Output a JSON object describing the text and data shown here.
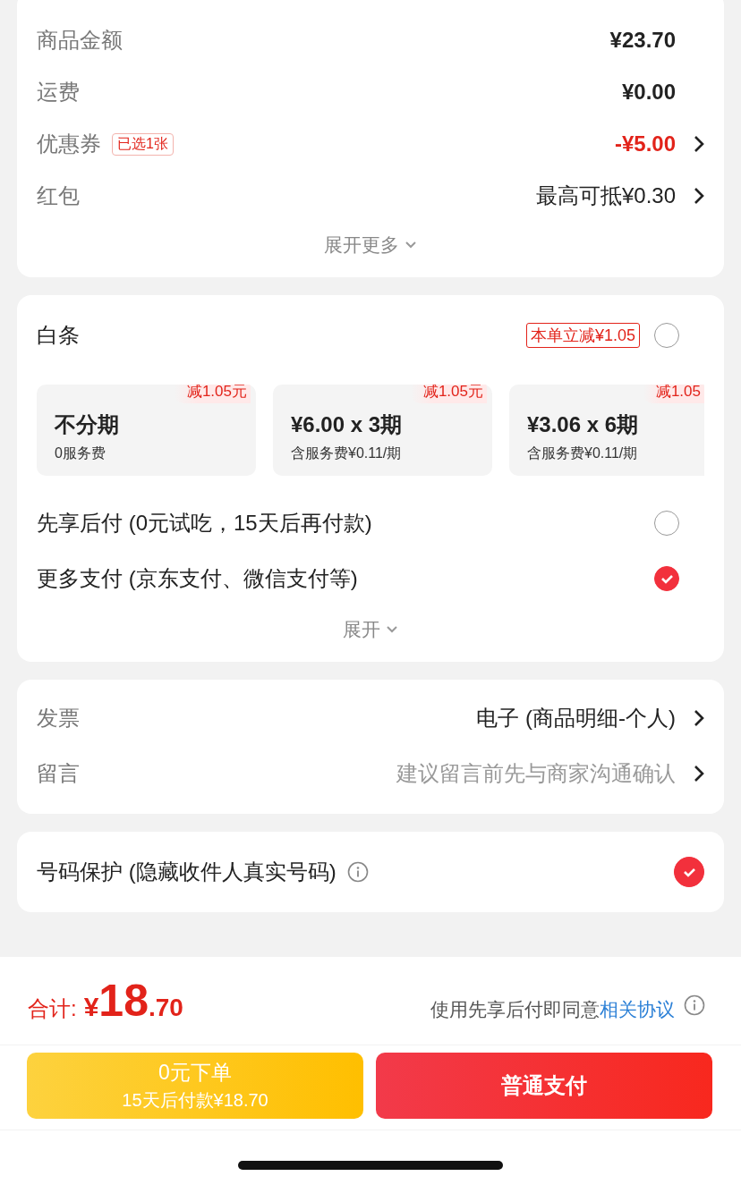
{
  "summary": {
    "rows": [
      {
        "label": "商品金额",
        "value": "¥23.70",
        "kind": "amount",
        "arrow": false
      },
      {
        "label": "运费",
        "value": "¥0.00",
        "kind": "amount",
        "arrow": false
      },
      {
        "label": "优惠券",
        "tag": "已选1张",
        "value": "-¥5.00",
        "kind": "discount",
        "arrow": true
      },
      {
        "label": "红包",
        "value": "最高可抵¥0.30",
        "kind": "normal",
        "arrow": true
      }
    ],
    "expand": "展开更多"
  },
  "payment": {
    "baitiao": {
      "label": "白条",
      "tag": "本单立减¥1.05",
      "selected": false,
      "plans": [
        {
          "badge": "减1.05元",
          "title": "不分期",
          "note": "0服务费"
        },
        {
          "badge": "减1.05元",
          "title": "¥6.00 x 3期",
          "note": "含服务费¥0.11/期"
        },
        {
          "badge": "减1.05",
          "title": "¥3.06 x 6期",
          "note": "含服务费¥0.11/期"
        }
      ]
    },
    "options": [
      {
        "label": "先享后付 (0元试吃，15天后再付款)",
        "selected": false
      },
      {
        "label": "更多支付 (京东支付、微信支付等)",
        "selected": true
      }
    ],
    "expand": "展开"
  },
  "details": [
    {
      "label": "发票",
      "value": "电子 (商品明细-个人)",
      "kind": "value"
    },
    {
      "label": "留言",
      "value": "建议留言前先与商家沟通确认",
      "kind": "hint"
    }
  ],
  "privacy": {
    "label": "号码保护 (隐藏收件人真实号码)",
    "checked": true
  },
  "footer": {
    "total_label": "合计:",
    "currency": "¥",
    "integer": "18",
    "decimal": ".70",
    "agreement": "使用先享后付即同意",
    "agreement_link": "相关协议",
    "buttons": [
      {
        "kind": "later",
        "title": "0元下单",
        "subtitle": "15天后付款¥18.70"
      },
      {
        "kind": "pay",
        "title": "普通支付"
      }
    ]
  }
}
